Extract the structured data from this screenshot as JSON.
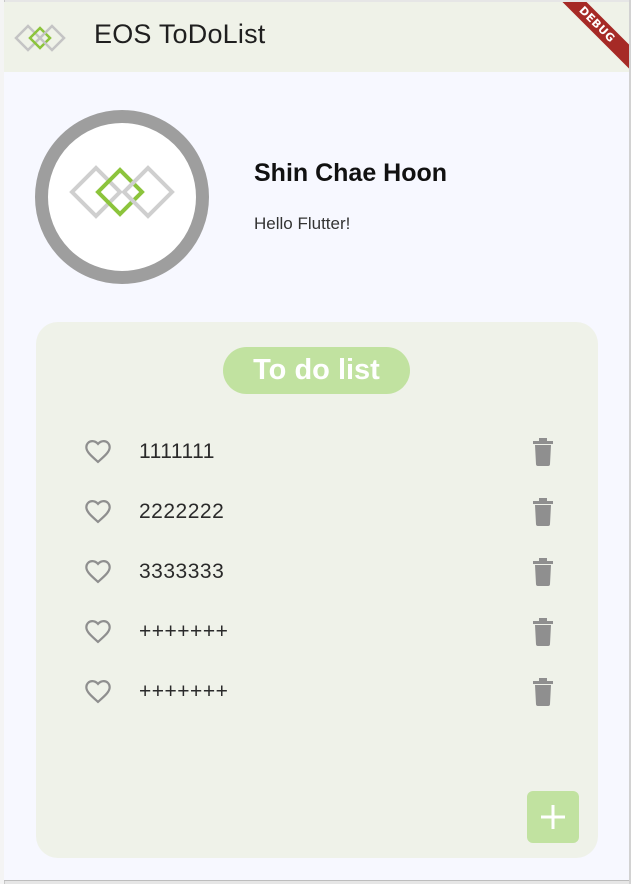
{
  "app": {
    "title": "EOS ToDoList",
    "debug_label": "DEBUG"
  },
  "profile": {
    "name": "Shin Chae Hoon",
    "message": "Hello Flutter!"
  },
  "todo": {
    "title": "To do list",
    "items": [
      {
        "text": "1111111",
        "liked": false
      },
      {
        "text": "2222222",
        "liked": false
      },
      {
        "text": "3333333",
        "liked": false
      },
      {
        "text": "+++++++",
        "liked": false
      },
      {
        "text": "+++++++",
        "liked": false
      }
    ]
  },
  "icons": {
    "logo": "eos-logo-icon",
    "like": "heart-outline-icon",
    "delete": "trash-icon",
    "add": "plus-icon"
  },
  "colors": {
    "appbar": "#eff2e8",
    "accent": "#c1e2a0",
    "logo_green": "#8cc43c",
    "icon_gray": "#8f8f8f",
    "debug_banner": "#a62a26"
  }
}
